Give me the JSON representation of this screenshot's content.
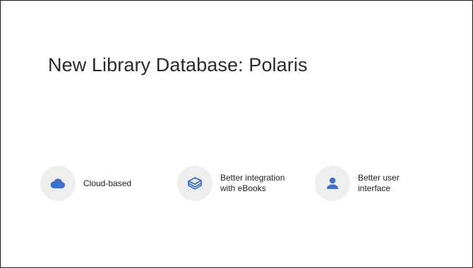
{
  "slide": {
    "title": "New Library Database: Polaris"
  },
  "features": [
    {
      "label": "Cloud-based",
      "icon": "cloud-icon"
    },
    {
      "label": "Better integration\nwith eBooks",
      "icon": "books-icon"
    },
    {
      "label": "Better user\ninterface",
      "icon": "user-icon"
    }
  ],
  "colors": {
    "icon_accent": "#3d6fd1",
    "icon_background": "#eeeeee",
    "title_text": "#2a2a2a"
  }
}
